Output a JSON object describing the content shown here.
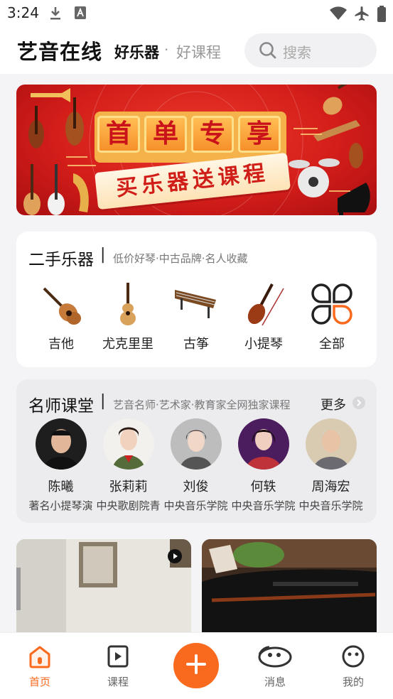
{
  "status_bar": {
    "time": "3:24"
  },
  "header": {
    "app_title": "艺音在线",
    "slogan_primary": "好乐器",
    "slogan_separator": "·",
    "slogan_secondary": "好课程",
    "search_placeholder": "搜索"
  },
  "banner": {
    "title_chars": [
      "首",
      "单",
      "专",
      "享"
    ],
    "subtitle": "买乐器送课程"
  },
  "second_hand": {
    "title": "二手乐器",
    "divider": "|",
    "subtitle": "低价好琴·中古品牌·名人收藏",
    "categories": [
      {
        "label": "吉他",
        "icon": "guitar-icon"
      },
      {
        "label": "尤克里里",
        "icon": "ukulele-icon"
      },
      {
        "label": "古筝",
        "icon": "guzheng-icon"
      },
      {
        "label": "小提琴",
        "icon": "violin-icon"
      },
      {
        "label": "全部",
        "icon": "grid-all-icon"
      }
    ]
  },
  "masters": {
    "title": "名师课堂",
    "divider": "|",
    "subtitle": "艺音名师·艺术家·教育家全网独家课程",
    "more_label": "更多",
    "teachers": [
      {
        "name": "陈曦",
        "title": "著名小提琴演"
      },
      {
        "name": "张莉莉",
        "title": "中央歌剧院青"
      },
      {
        "name": "刘俊",
        "title": "中央音乐学院"
      },
      {
        "name": "何轶",
        "title": "中央音乐学院"
      },
      {
        "name": "周海宏",
        "title": "中央音乐学院"
      }
    ]
  },
  "bottom_nav": {
    "items": [
      {
        "label": "首页",
        "icon": "home-icon",
        "active": true
      },
      {
        "label": "课程",
        "icon": "course-play-icon",
        "active": false
      },
      {
        "label": "消息",
        "icon": "message-icon",
        "active": false
      },
      {
        "label": "我的",
        "icon": "profile-icon",
        "active": false
      }
    ],
    "fab_icon": "plus-icon"
  },
  "colors": {
    "accent": "#fa6a1e",
    "banner_red": "#d41e1a",
    "background": "#f4f4f6"
  }
}
